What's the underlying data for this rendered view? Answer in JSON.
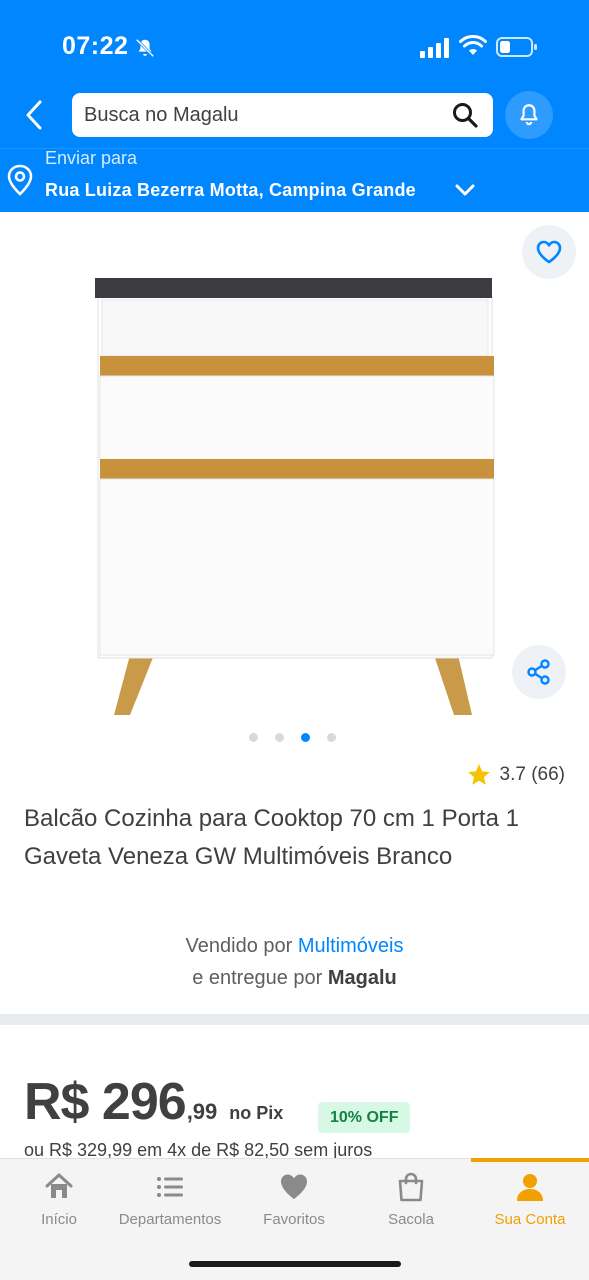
{
  "status_bar": {
    "time": "07:22"
  },
  "header": {
    "search_placeholder": "Busca no Magalu",
    "deliver_label": "Enviar para",
    "deliver_address": "Rua Luiza Bezerra Motta, Campina Grande"
  },
  "product": {
    "carousel": {
      "total": 4,
      "active_index": 2
    },
    "rating": "3.7 (66)",
    "title": "Balcão Cozinha para Cooktop 70 cm 1 Porta 1 Gaveta Veneza GW Multimóveis Branco",
    "seller_prefix": "Vendido por",
    "seller_name": "Multimóveis",
    "delivery_prefix": "e entregue por",
    "delivery_name": "Magalu"
  },
  "price": {
    "main": "R$ 296",
    "cents": ",99",
    "method": "no Pix",
    "discount_badge": "10% OFF",
    "installments": "ou R$ 329,99 em 4x de R$ 82,50 sem juros"
  },
  "bottom_nav": {
    "items": [
      {
        "label": "Início",
        "icon": "home-icon"
      },
      {
        "label": "Departamentos",
        "icon": "menu-list-icon"
      },
      {
        "label": "Favoritos",
        "icon": "heart-icon"
      },
      {
        "label": "Sacola",
        "icon": "bag-icon"
      },
      {
        "label": "Sua Conta",
        "icon": "user-icon"
      }
    ],
    "active_index": 4
  },
  "colors": {
    "brand_blue": "#0086ff",
    "active_orange": "#f2a000",
    "discount_green": "#128344"
  }
}
